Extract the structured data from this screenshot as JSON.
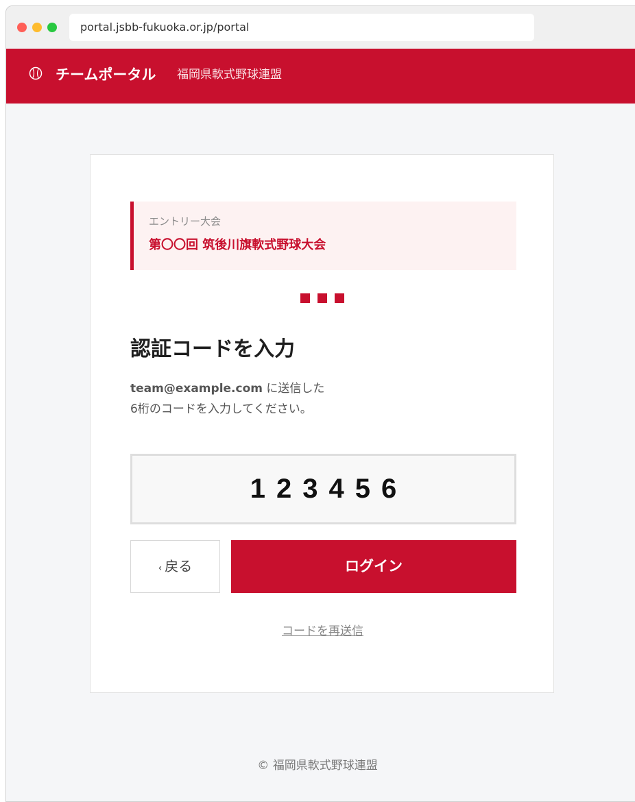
{
  "browser": {
    "url": "portal.jsbb-fukuoka.or.jp/portal"
  },
  "header": {
    "brand": "チームポータル",
    "organization": "福岡県軟式野球連盟",
    "icon": "baseball-icon"
  },
  "entry": {
    "label": "エントリー大会",
    "tournament": "第〇〇回 筑後川旗軟式野球大会"
  },
  "steps": {
    "count": 3,
    "current": 3
  },
  "auth": {
    "title": "認証コードを入力",
    "email": "team@example.com",
    "desc_after_email": " に送信した",
    "desc_line2": "6桁のコードを入力してください。",
    "code_value": "123456"
  },
  "buttons": {
    "back_label": "戻る",
    "back_icon": "chevron-left-icon",
    "login_label": "ログイン",
    "resend_label": "コードを再送信"
  },
  "footer": {
    "copyright": "© 福岡県軟式野球連盟"
  },
  "colors": {
    "brand_red": "#c8102e",
    "page_bg": "#f5f6f8"
  }
}
